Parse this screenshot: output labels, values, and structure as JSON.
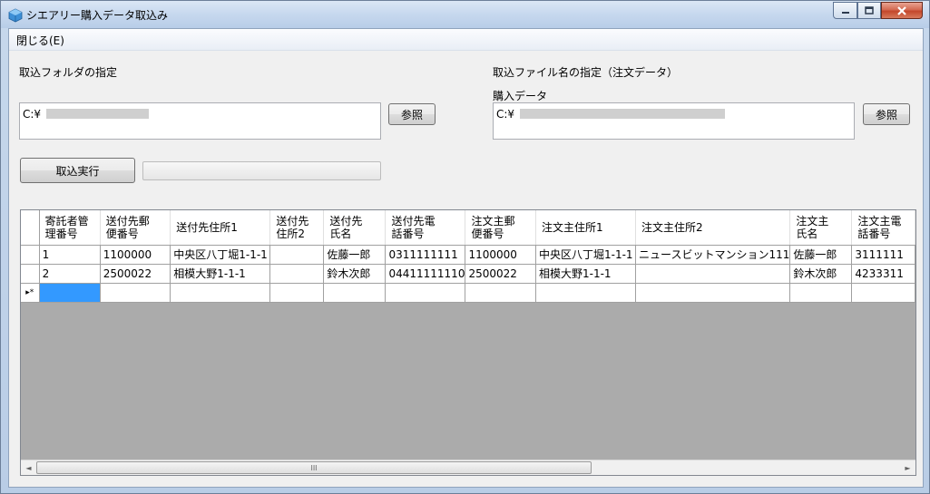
{
  "window": {
    "title": "シエアリー購入データ取込み"
  },
  "menu": {
    "close_label": "閉じる(E)"
  },
  "folder": {
    "label": "取込フォルダの指定",
    "path": "C:¥",
    "browse_label": "参照"
  },
  "file": {
    "label": "取込ファイル名の指定（注文データ）",
    "sublabel": "購入データ",
    "path": "C:¥",
    "browse_label": "参照"
  },
  "import_button": "取込実行",
  "grid": {
    "columns": [
      "寄託者管\n理番号",
      "送付先郵\n便番号",
      "送付先住所1",
      "送付先\n住所2",
      "送付先\n氏名",
      "送付先電\n話番号",
      "注文主郵\n便番号",
      "注文主住所1",
      "注文主住所2",
      "注文主\n氏名",
      "注文主電\n話番号"
    ],
    "rows": [
      [
        "1",
        "1100000",
        "中央区八丁堀1-1-1",
        "",
        "佐藤一郎",
        "0311111111",
        "1100000",
        "中央区八丁堀1-1-1",
        "ニュースビットマンション111",
        "佐藤一郎",
        "3111111"
      ],
      [
        "2",
        "2500022",
        "相模大野1-1-1",
        "",
        "鈴木次郎",
        "04411111110",
        "2500022",
        "相模大野1-1-1",
        "",
        "鈴木次郎",
        "4233311"
      ]
    ],
    "new_row_marker": "▸*"
  },
  "scrollbar": {
    "grip": "III",
    "left_arrow": "◄",
    "right_arrow": "►"
  }
}
